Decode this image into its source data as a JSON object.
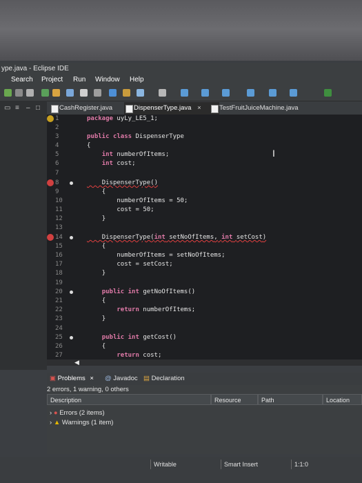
{
  "window": {
    "title": "ype.java - Eclipse IDE"
  },
  "menu": [
    "Search",
    "Project",
    "Run",
    "Window",
    "Help"
  ],
  "editor_tabs": [
    {
      "label": "CashRegister.java"
    },
    {
      "label": "DispenserType.java",
      "close": "×"
    },
    {
      "label": "TestFruitJuiceMachine.java"
    }
  ],
  "code_lines": [
    {
      "num": "1",
      "text": "package uyLy_LE5_1;"
    },
    {
      "num": "2",
      "text": ""
    },
    {
      "num": "3",
      "text": "public class DispenserType"
    },
    {
      "num": "4",
      "text": "{"
    },
    {
      "num": "5",
      "text": "    int numberOfItems;"
    },
    {
      "num": "6",
      "text": "    int cost;"
    },
    {
      "num": "7",
      "text": ""
    },
    {
      "num": "8",
      "text": "    DispenserType()"
    },
    {
      "num": "9",
      "text": "    {"
    },
    {
      "num": "10",
      "text": "        numberOfItems = 50;"
    },
    {
      "num": "11",
      "text": "        cost = 50;"
    },
    {
      "num": "12",
      "text": "    }"
    },
    {
      "num": "13",
      "text": ""
    },
    {
      "num": "14",
      "text": "    DispenserType(int setNoOfItems, int setCost)"
    },
    {
      "num": "15",
      "text": "    {"
    },
    {
      "num": "16",
      "text": "        numberOfItems = setNoOfItems;"
    },
    {
      "num": "17",
      "text": "        cost = setCost;"
    },
    {
      "num": "18",
      "text": "    }"
    },
    {
      "num": "19",
      "text": ""
    },
    {
      "num": "20",
      "text": "    public int getNoOfItems()"
    },
    {
      "num": "21",
      "text": "    {"
    },
    {
      "num": "22",
      "text": "        return numberOfItems;"
    },
    {
      "num": "23",
      "text": "    }"
    },
    {
      "num": "24",
      "text": ""
    },
    {
      "num": "25",
      "text": "    public int getCost()"
    },
    {
      "num": "26",
      "text": "    {"
    },
    {
      "num": "27",
      "text": "        return cost;"
    }
  ],
  "bottom_tabs": {
    "problems": "Problems",
    "problems_close": "×",
    "javadoc": "Javadoc",
    "declaration": "Declaration"
  },
  "problems": {
    "summary": "2 errors, 1 warning, 0 others",
    "columns": [
      "Description",
      "Resource",
      "Path",
      "Location"
    ],
    "rows": [
      {
        "label": "Errors (2 items)"
      },
      {
        "label": "Warnings (1 item)"
      }
    ]
  },
  "status_bar": {
    "writable": "Writable",
    "insert_mode": "Smart Insert",
    "position": "1:1:0"
  },
  "colors": {
    "error": "#d04040",
    "keyword": "#e07aa8",
    "background": "#1e1f22"
  }
}
